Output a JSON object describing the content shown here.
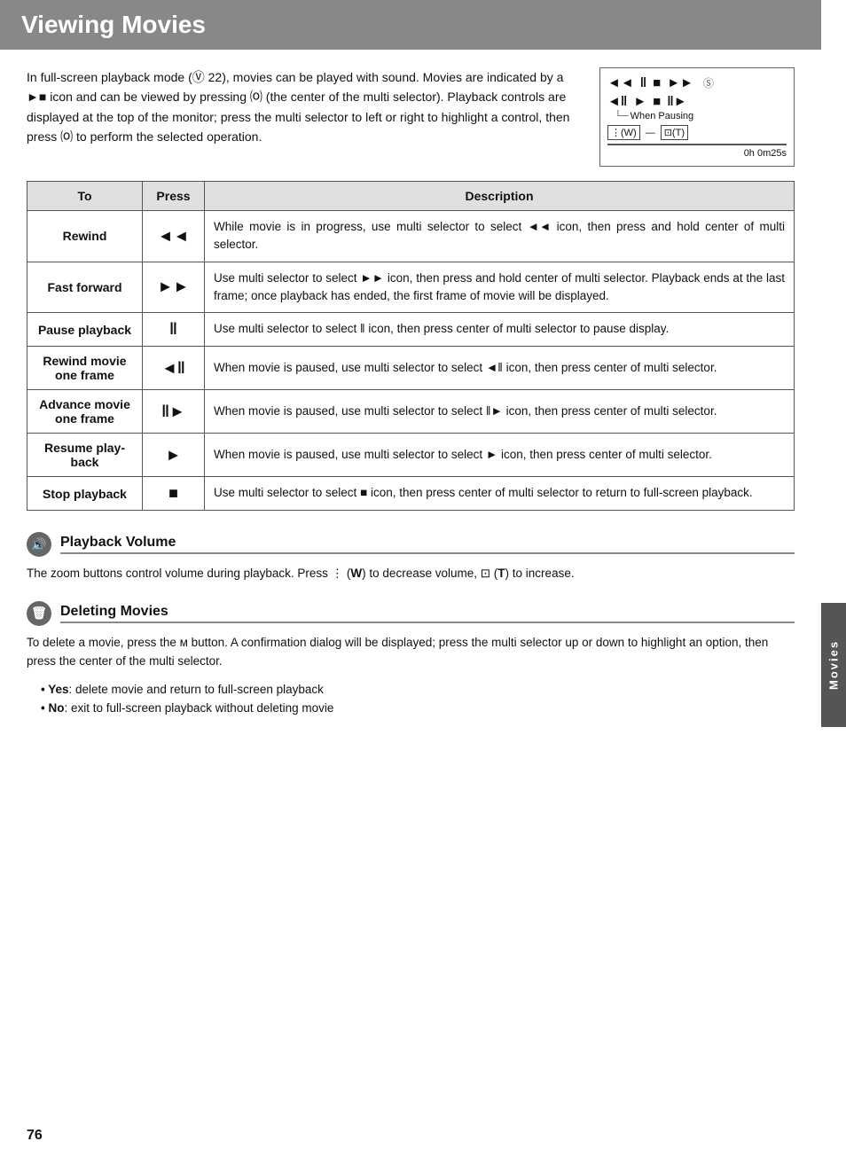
{
  "header": {
    "title": "Viewing Movies"
  },
  "side_tab": {
    "label": "Movies"
  },
  "intro": {
    "text": "In full-screen playback mode (Ⓥ 22), movies can be played with sound. Movies are indicated by a ►■ icon and can be viewed by pressing ⒪ (the center of the multi selector). Playback controls are displayed at the top of the monitor; press the multi selector to left or right to highlight a control, then press ⒪ to perform the selected operation."
  },
  "controls_image": {
    "row1": [
      "◄◄",
      "‖",
      "■",
      "►►"
    ],
    "row2": [
      "◄‖",
      "►",
      "■",
      "‖►"
    ],
    "when_pausing": "When Pausing",
    "zoom_w": "W",
    "zoom_t": "T",
    "progress": "0h 0m25s"
  },
  "table": {
    "headers": [
      "To",
      "Press",
      "Description"
    ],
    "rows": [
      {
        "to": "Rewind",
        "press": "◄◄",
        "description": "While movie is in progress, use multi selector to select ◄◄ icon, then press and hold center of multi selector."
      },
      {
        "to": "Fast forward",
        "press": "►►",
        "description": "Use multi selector to select ►► icon, then press and hold center of multi selector. Playback ends at the last frame; once playback has ended, the first frame of movie will be displayed."
      },
      {
        "to": "Pause playback",
        "press": "‖",
        "description": "Use multi selector to select ‖ icon, then press center of multi selector to pause display."
      },
      {
        "to": "Rewind movie\none frame",
        "press": "◄‖",
        "description": "When movie is paused, use multi selector to select ◄‖ icon, then press center of multi selector."
      },
      {
        "to": "Advance movie\none frame",
        "press": "‖►",
        "description": "When movie is paused, use multi selector to select ‖► icon, then press center of multi selector."
      },
      {
        "to": "Resume play-\nback",
        "press": "►",
        "description": "When movie is paused, use multi selector to select ► icon, then press center of multi selector."
      },
      {
        "to": "Stop playback",
        "press": "■",
        "description": "Use multi selector to select ■ icon, then press center of multi selector to return to full-screen playback."
      }
    ]
  },
  "sections": {
    "playback_volume": {
      "heading": "Playback Volume",
      "body": "The zoom buttons control volume during playback. Press ⋮ (W) to decrease volume, ⊡ (T) to increase."
    },
    "deleting_movies": {
      "heading": "Deleting Movies",
      "body": "To delete a movie, press the ᴍ button. A confirmation dialog will be displayed; press the multi selector up or down to highlight an option, then press the center of the multi selector.",
      "bullets": [
        "Yes: delete movie and return to full-screen playback",
        "No: exit to full-screen playback without deleting movie"
      ]
    }
  },
  "page_number": "76"
}
